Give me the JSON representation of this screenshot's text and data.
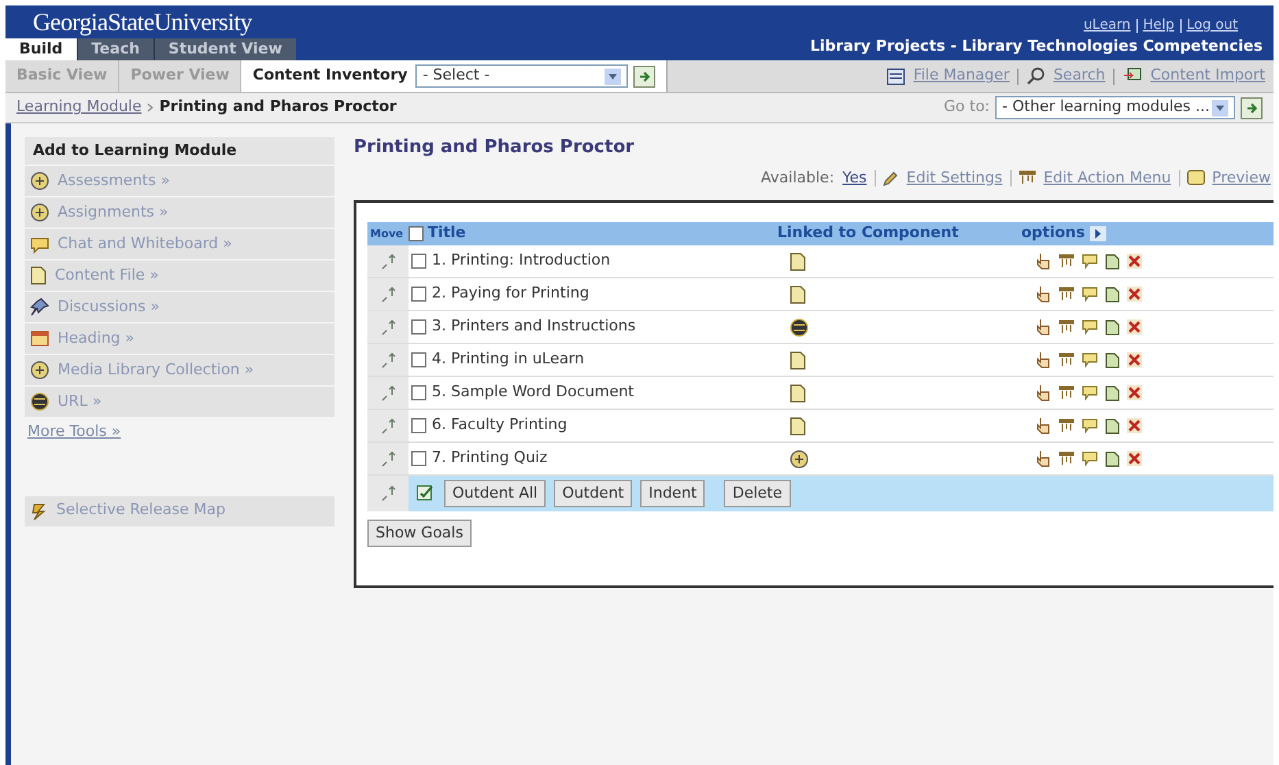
{
  "header": {
    "logo": "GeorgiaStateUniversity",
    "links": [
      "uLearn",
      "Help",
      "Log out"
    ],
    "project": "Library Projects - Library Technologies Competencies"
  },
  "tabs": [
    {
      "label": "Build",
      "selected": true
    },
    {
      "label": "Teach",
      "selected": false
    },
    {
      "label": "Student View",
      "selected": false
    }
  ],
  "view_tabs": [
    {
      "label": "Basic View",
      "selected": false
    },
    {
      "label": "Power View",
      "selected": false
    },
    {
      "label": "Content Inventory",
      "selected": true
    }
  ],
  "inventory_select": {
    "value": "- Select -"
  },
  "tools": [
    {
      "label": "File Manager",
      "kind": "files"
    },
    {
      "label": "Search",
      "kind": "search"
    },
    {
      "label": "Content Import",
      "kind": "import"
    }
  ],
  "breadcrumb": [
    "Learning Module",
    "Printing and Pharos Proctor"
  ],
  "goto": {
    "label": "Go to:",
    "value": "- Other learning modules ..."
  },
  "sidebar": {
    "heading": "Add to Learning Module",
    "items": [
      {
        "label": "Assessments »",
        "kind": "assessment"
      },
      {
        "label": "Assignments »",
        "kind": "assignment"
      },
      {
        "label": "Chat and Whiteboard »",
        "kind": "chat"
      },
      {
        "label": "Content File »",
        "kind": "file"
      },
      {
        "label": "Discussions »",
        "kind": "discussion"
      },
      {
        "label": "Heading »",
        "kind": "heading"
      },
      {
        "label": "Media Library Collection »",
        "kind": "media"
      },
      {
        "label": "URL »",
        "kind": "url"
      }
    ],
    "more_tools": "More Tools »",
    "release_map": "Selective Release Map"
  },
  "main": {
    "title": "Printing and Pharos Proctor",
    "available_label": "Available:",
    "available_value": "Yes",
    "actions": [
      {
        "label": "Edit Settings",
        "kind": "edit"
      },
      {
        "label": "Edit Action Menu",
        "kind": "menu"
      },
      {
        "label": "Preview",
        "kind": "preview"
      }
    ]
  },
  "table": {
    "columns": [
      "Move",
      "Title",
      "Linked to Component",
      "options"
    ],
    "select_all": {
      "checked": false
    },
    "rows": [
      {
        "title": "1. Printing: Introduction",
        "checked": false,
        "kind": "file"
      },
      {
        "title": "2. Paying for Printing",
        "checked": false,
        "kind": "file"
      },
      {
        "title": "3. Printers and Instructions",
        "checked": false,
        "kind": "url"
      },
      {
        "title": "4. Printing in uLearn",
        "checked": false,
        "kind": "file"
      },
      {
        "title": "5. Sample Word Document",
        "checked": false,
        "kind": "file"
      },
      {
        "title": "6. Faculty Printing",
        "checked": false,
        "kind": "file"
      },
      {
        "title": "7. Printing Quiz",
        "checked": false,
        "kind": "assessment"
      }
    ],
    "footer_buttons": [
      "Outdent All",
      "Outdent",
      "Indent",
      "Delete"
    ]
  },
  "show_goals": "Show Goals"
}
